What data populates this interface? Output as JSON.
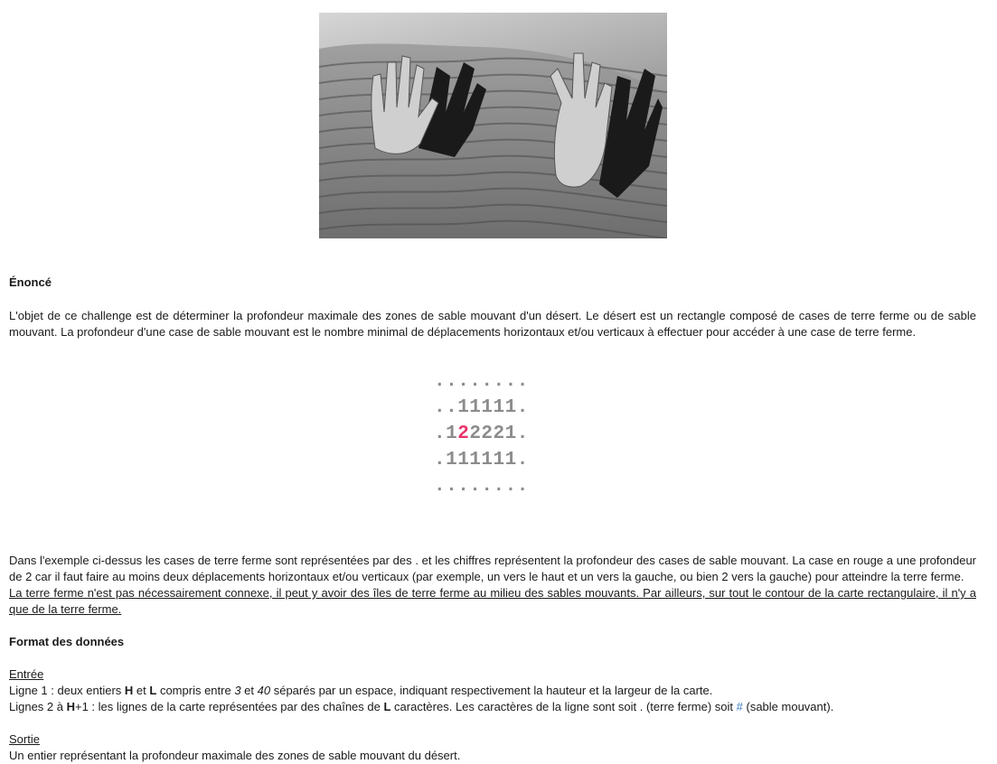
{
  "heading_enonce": "Énoncé",
  "intro": "L'objet de ce challenge est de déterminer la profondeur maximale des zones de sable mouvant d'un désert. Le désert est un rectangle composé de cases de terre ferme ou de sable mouvant. La profondeur d'une case de sable mouvant est le nombre minimal de déplacements horizontaux et/ou verticaux à effectuer pour accéder à une case de terre ferme.",
  "grid": {
    "rows": [
      "........",
      "..11111.",
      ".1",
      "111111.",
      "........"
    ],
    "row3_highlight": "2",
    "row3_rest": "2221.",
    "row4": ".111111.",
    "highlight_color": "#e8336b"
  },
  "explanation": "Dans l'exemple ci-dessus les cases de terre ferme sont représentées par des . et les chiffres représentent la profondeur des cases de sable mouvant. La case en rouge a une profondeur de 2 car il faut faire au moins deux déplacements horizontaux et/ou verticaux (par exemple, un vers le haut et un vers la gauche, ou bien 2 vers la gauche) pour atteindre la terre ferme.",
  "note": "La terre ferme n'est pas nécessairement connexe, il peut y avoir des îles de terre ferme au milieu des sables mouvants. Par ailleurs, sur tout le contour de la carte rectangulaire, il n'y a que de la terre ferme.",
  "heading_format": "Format des données",
  "entree_label": "Entrée",
  "line1": {
    "a": "Ligne 1 : deux entiers ",
    "h": "H",
    "b": " et ",
    "l": "L",
    "c": " compris entre ",
    "min": "3",
    "d": " et ",
    "max": "40",
    "e": " séparés par un espace, indiquant respectivement la hauteur et la largeur de la carte."
  },
  "line2": {
    "a": "Lignes 2 à ",
    "h": "H",
    "b": "+1 : les lignes de la carte représentées par des chaînes de ",
    "l": "L",
    "c": " caractères. Les caractères de la ligne sont soit . (terre ferme) soit ",
    "hash": "#",
    "d": " (sable mouvant)."
  },
  "sortie_label": "Sortie",
  "sortie_text": "Un entier représentant la profondeur maximale des zones de sable mouvant du désert."
}
